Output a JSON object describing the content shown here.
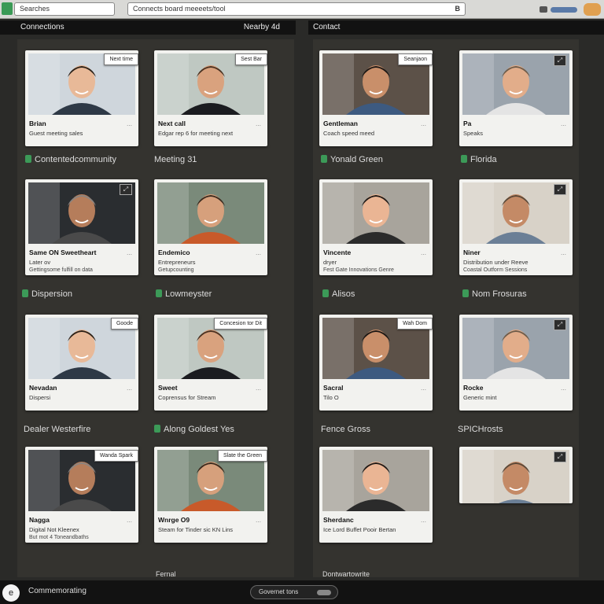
{
  "topbar": {
    "left_input": "Searches",
    "url_input": "Connects board meeeets/tool",
    "url_icon_label": "B"
  },
  "panels": {
    "left": {
      "title": "Connections",
      "action": "Nearby 4d"
    },
    "right": {
      "title": "Contact"
    }
  },
  "tiles": [
    {
      "name": "Brian",
      "line2": "Guest meeting sales",
      "tag": "Next time"
    },
    {
      "name": "Next call",
      "line2": "Edgar rep 6 for meeting next",
      "tag": "Sest Bar"
    },
    {
      "name": "Gentleman",
      "line2": "Coach speed meed",
      "tag": "Seanjaon"
    },
    {
      "name": "Pa",
      "line2": "Speaks",
      "tag": ""
    },
    {
      "name": "Same ON Sweetheart",
      "line2": "Later ov",
      "line3": "Gettingsome fulfill on data",
      "tag": ""
    },
    {
      "name": "Endemico",
      "line2": "Entrepreneurs",
      "line3": "Getupcounting",
      "tag": ""
    },
    {
      "name": "Vincente",
      "line2": "dryer",
      "line3": "Fest Gate Innovations Genre",
      "tag": ""
    },
    {
      "name": "Niner",
      "line2": "Distribution under Reeve",
      "line3": "Coastal Outform Sessions",
      "tag": ""
    },
    {
      "name": "Nevadan",
      "line2": "Dispersi",
      "tag": "Goode"
    },
    {
      "name": "Sweet",
      "line2": "Coprensus for Stream",
      "tag": "Concesion tor Dit"
    },
    {
      "name": "Sacral",
      "line2": "Tilo O",
      "tag": "Wah Dom"
    },
    {
      "name": "Rocke",
      "line2": "Generic mint",
      "tag": ""
    },
    {
      "name": "Nagga",
      "line2": "Digital Not Kleenex",
      "line3": "But mot 4 Toneandbaths",
      "tag": "Wanda Spark"
    },
    {
      "name": "Wnrge O9",
      "line2": "Steam for Tinder sic KN Lins",
      "tag": "Slate the Green"
    },
    {
      "name": "Sherdanc",
      "line2": "Ice Lord Buffet Pooir Bertan",
      "tag": ""
    },
    {
      "name": "",
      "line2": "",
      "tag": ""
    }
  ],
  "row_labels": {
    "r1_left_a": "Contentedcommunity",
    "r1_left_b": "Meeting 31",
    "r1_right_a": "Yonald Green",
    "r1_right_b": "Florida",
    "r2_left_a": "Dispersion",
    "r2_left_b": "Lowmeyster",
    "r2_right_a": "Alisos",
    "r2_right_b": "Nom Frosuras",
    "r3_left_a": "Dealer Westerfire",
    "r3_left_b": "Along Goldest Yes",
    "r3_right_a": "Fence Gross",
    "r3_right_b": "SPICHrosts",
    "r4_left_b": "Fernal",
    "r4_right_a": "Dontwartowrite"
  },
  "bottombar": {
    "avatar_letter": "e",
    "label": "Commemorating",
    "pill": "Governet tons"
  },
  "colors": {
    "accent_green": "#3c9a58",
    "bar_dark": "#121212",
    "board": "#34332f"
  }
}
